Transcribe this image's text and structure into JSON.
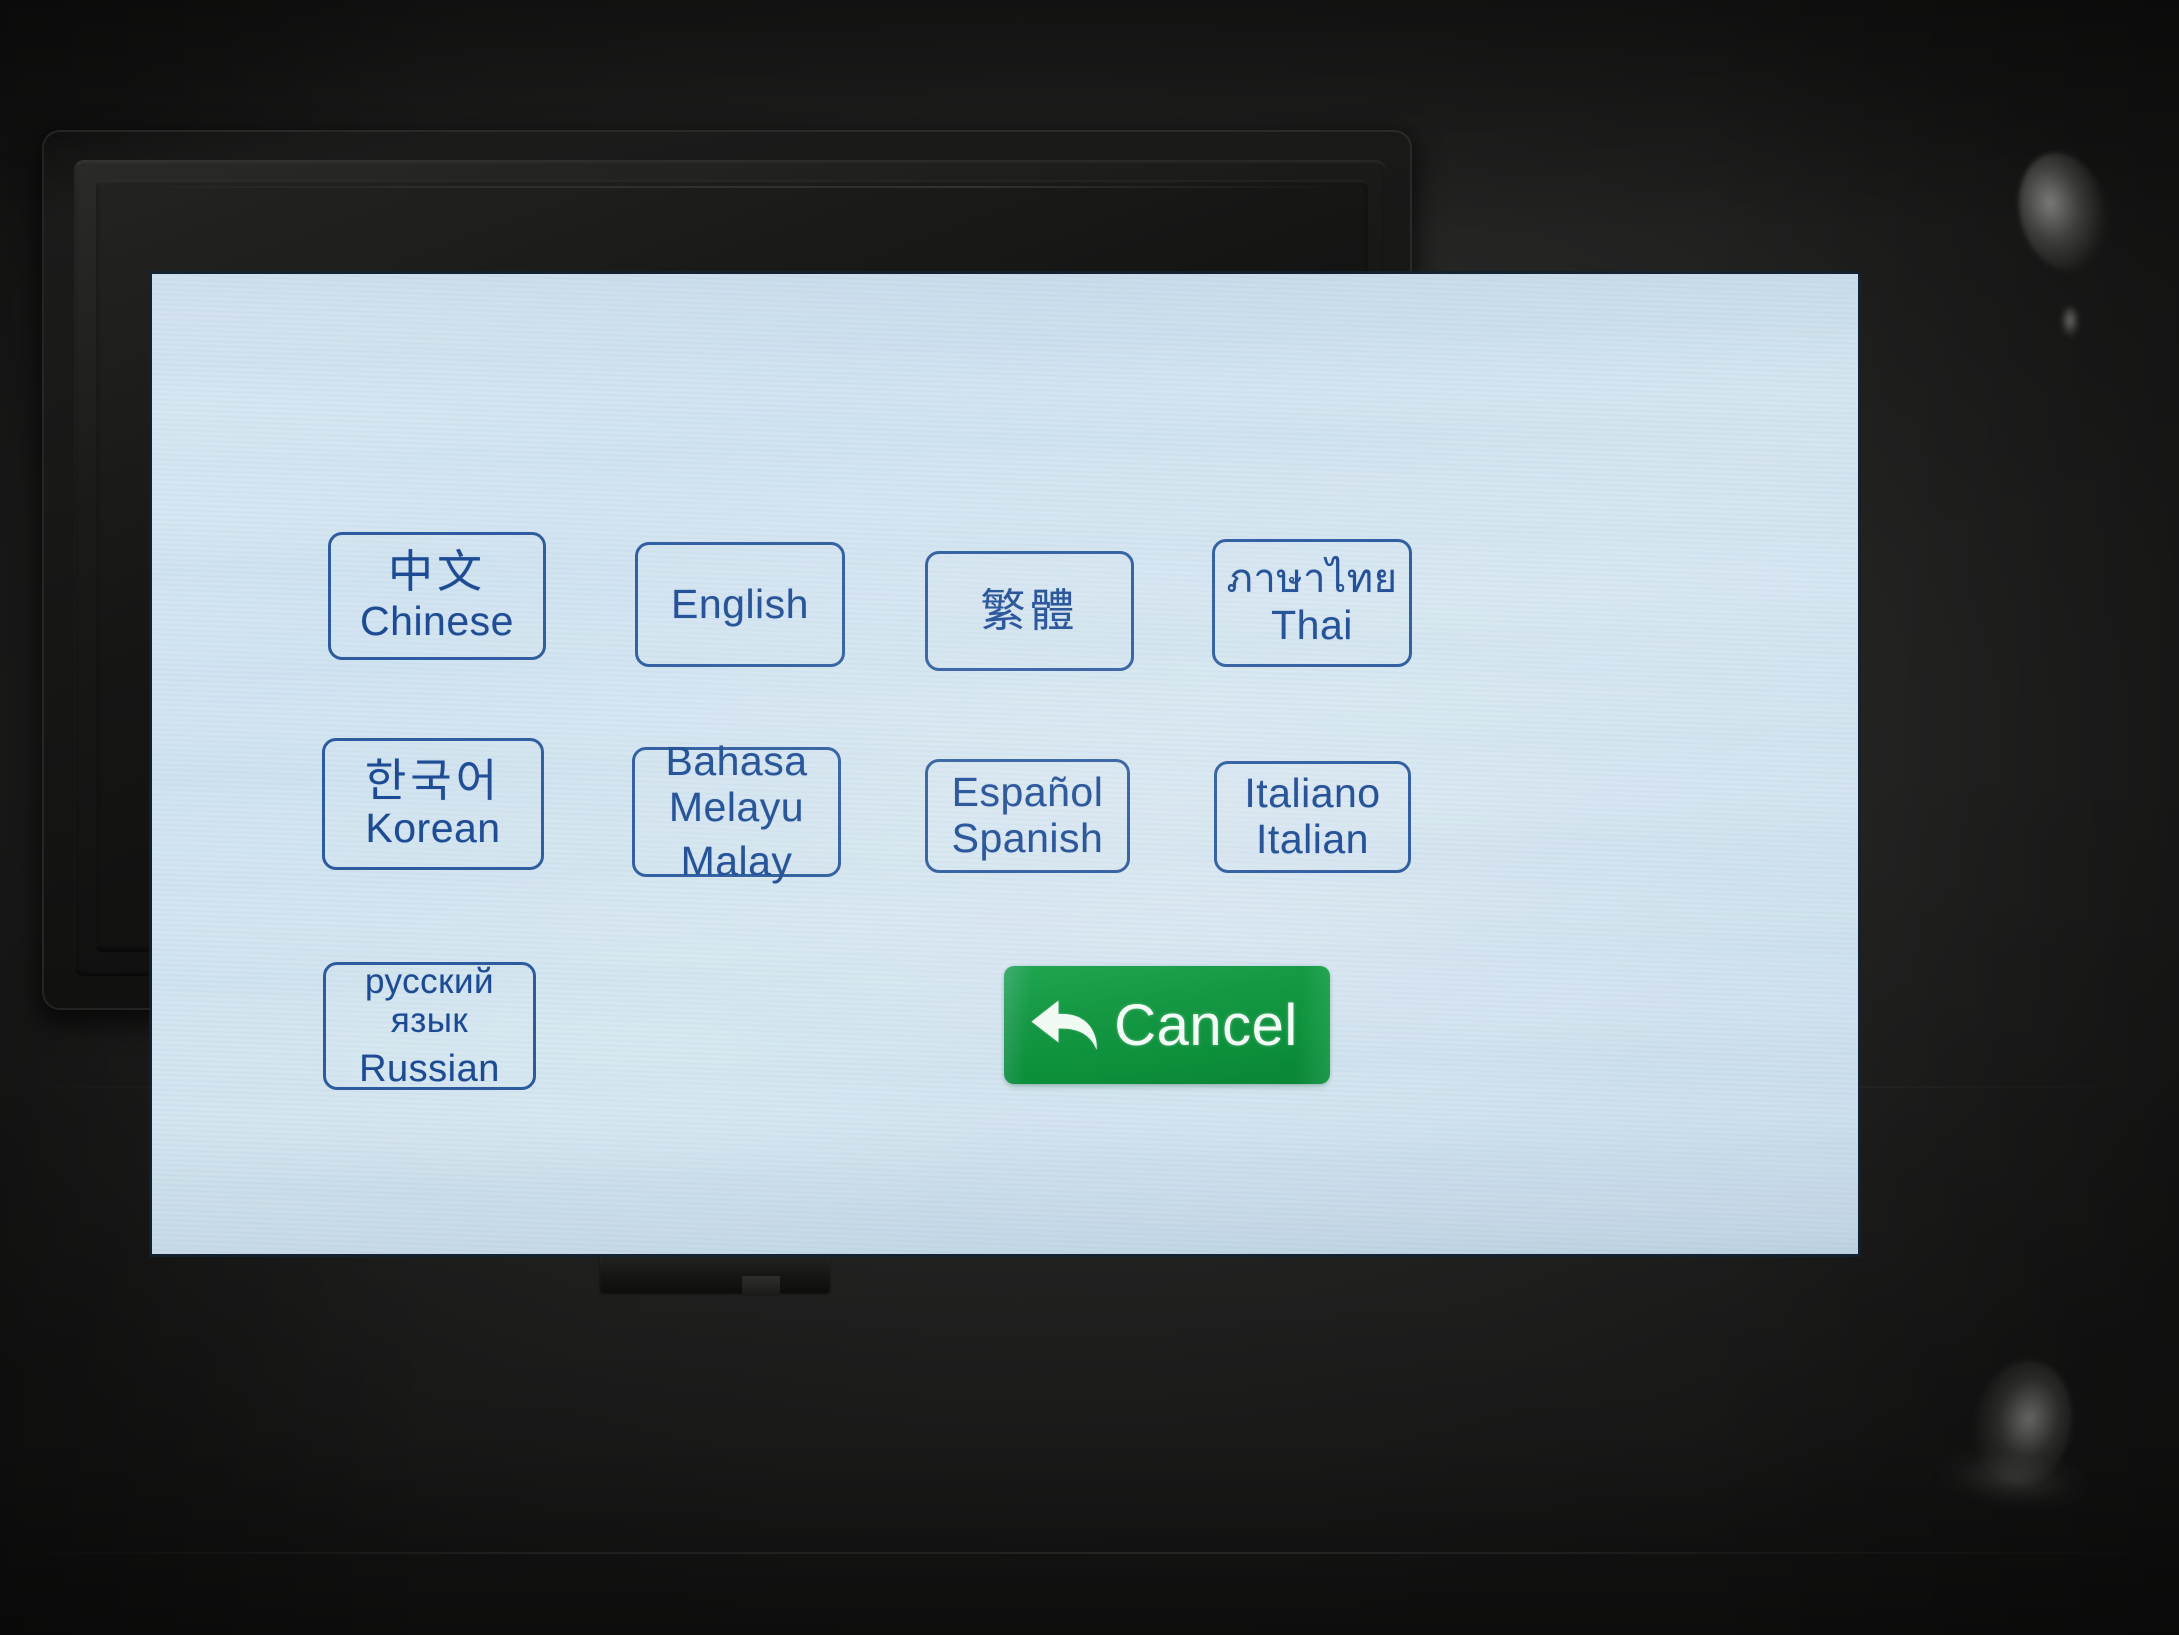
{
  "device": {
    "kind": "touchscreen-kiosk-terminal",
    "screen_background_color": "#d2e4ef",
    "bezel_color": "#141413",
    "housing_color": "#2c2c2b"
  },
  "screen": {
    "accent_color": "#2d5b9e",
    "text_color": "#1d4b93",
    "cancel_color": "#0b9440",
    "cancel_text_color": "#f2fbf5"
  },
  "languages": [
    {
      "id": "chinese",
      "native": "中文",
      "latin": "Chinese",
      "divider": false
    },
    {
      "id": "english",
      "native": "English",
      "latin": "",
      "divider": false
    },
    {
      "id": "traditional",
      "native": "繁體",
      "latin": "",
      "divider": false
    },
    {
      "id": "thai",
      "native": "ภาษาไทย",
      "latin": "Thai",
      "divider": false
    },
    {
      "id": "korean",
      "native": "한국어",
      "latin": "Korean",
      "divider": false
    },
    {
      "id": "malay",
      "native_line1": "Bahasa",
      "native_line2": "Melayu",
      "latin": "Malay",
      "divider": true
    },
    {
      "id": "spanish",
      "native": "Español",
      "latin": "Spanish",
      "divider": false
    },
    {
      "id": "italian",
      "native": "Italiano",
      "latin": "Italian",
      "divider": false
    },
    {
      "id": "russian",
      "native_line1": "русский",
      "native_line2": "язык",
      "latin": "Russian",
      "divider": true
    }
  ],
  "cancel": {
    "label": "Cancel",
    "icon": "back-arrow-icon"
  }
}
